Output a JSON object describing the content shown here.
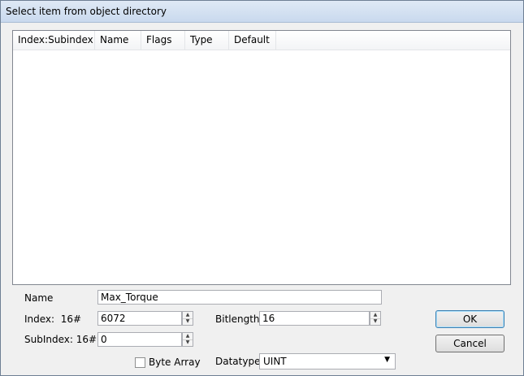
{
  "window": {
    "title": "Select item from object directory"
  },
  "list": {
    "columns": [
      "Index:Subindex",
      "Name",
      "Flags",
      "Type",
      "Default"
    ],
    "rows": []
  },
  "form": {
    "name_label": "Name",
    "name_value": "Max_Torque",
    "index_label": "Index:",
    "index_prefix": "16#",
    "index_value": "6072",
    "subindex_label": "SubIndex:",
    "subindex_prefix": "16#",
    "subindex_value": "0",
    "bitlength_label": "Bitlength:",
    "bitlength_value": "16",
    "byte_array_label": "Byte Array",
    "byte_array_checked": false,
    "datatype_label": "Datatype:",
    "datatype_value": "UINT"
  },
  "buttons": {
    "ok": "OK",
    "cancel": "Cancel"
  }
}
